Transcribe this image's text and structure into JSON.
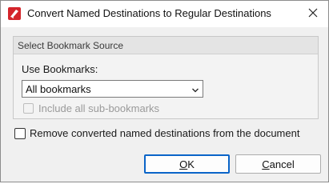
{
  "window": {
    "title": "Convert Named Destinations to Regular Destinations",
    "app_icon": "pdf-editor-icon",
    "close_icon": "close-icon"
  },
  "group": {
    "title": "Select Bookmark Source",
    "use_label": "Use Bookmarks:",
    "select": {
      "value": "All bookmarks"
    },
    "include_sub": {
      "label": "Include all sub-bookmarks",
      "checked": false,
      "disabled": true
    }
  },
  "remove_option": {
    "label": "Remove converted named destinations from the document",
    "checked": false
  },
  "buttons": {
    "ok": {
      "mnemonic": "O",
      "rest": "K"
    },
    "cancel": {
      "mnemonic": "C",
      "rest": "ancel"
    }
  },
  "colors": {
    "accent": "#0a64c8",
    "app_icon_red": "#d4252b"
  }
}
